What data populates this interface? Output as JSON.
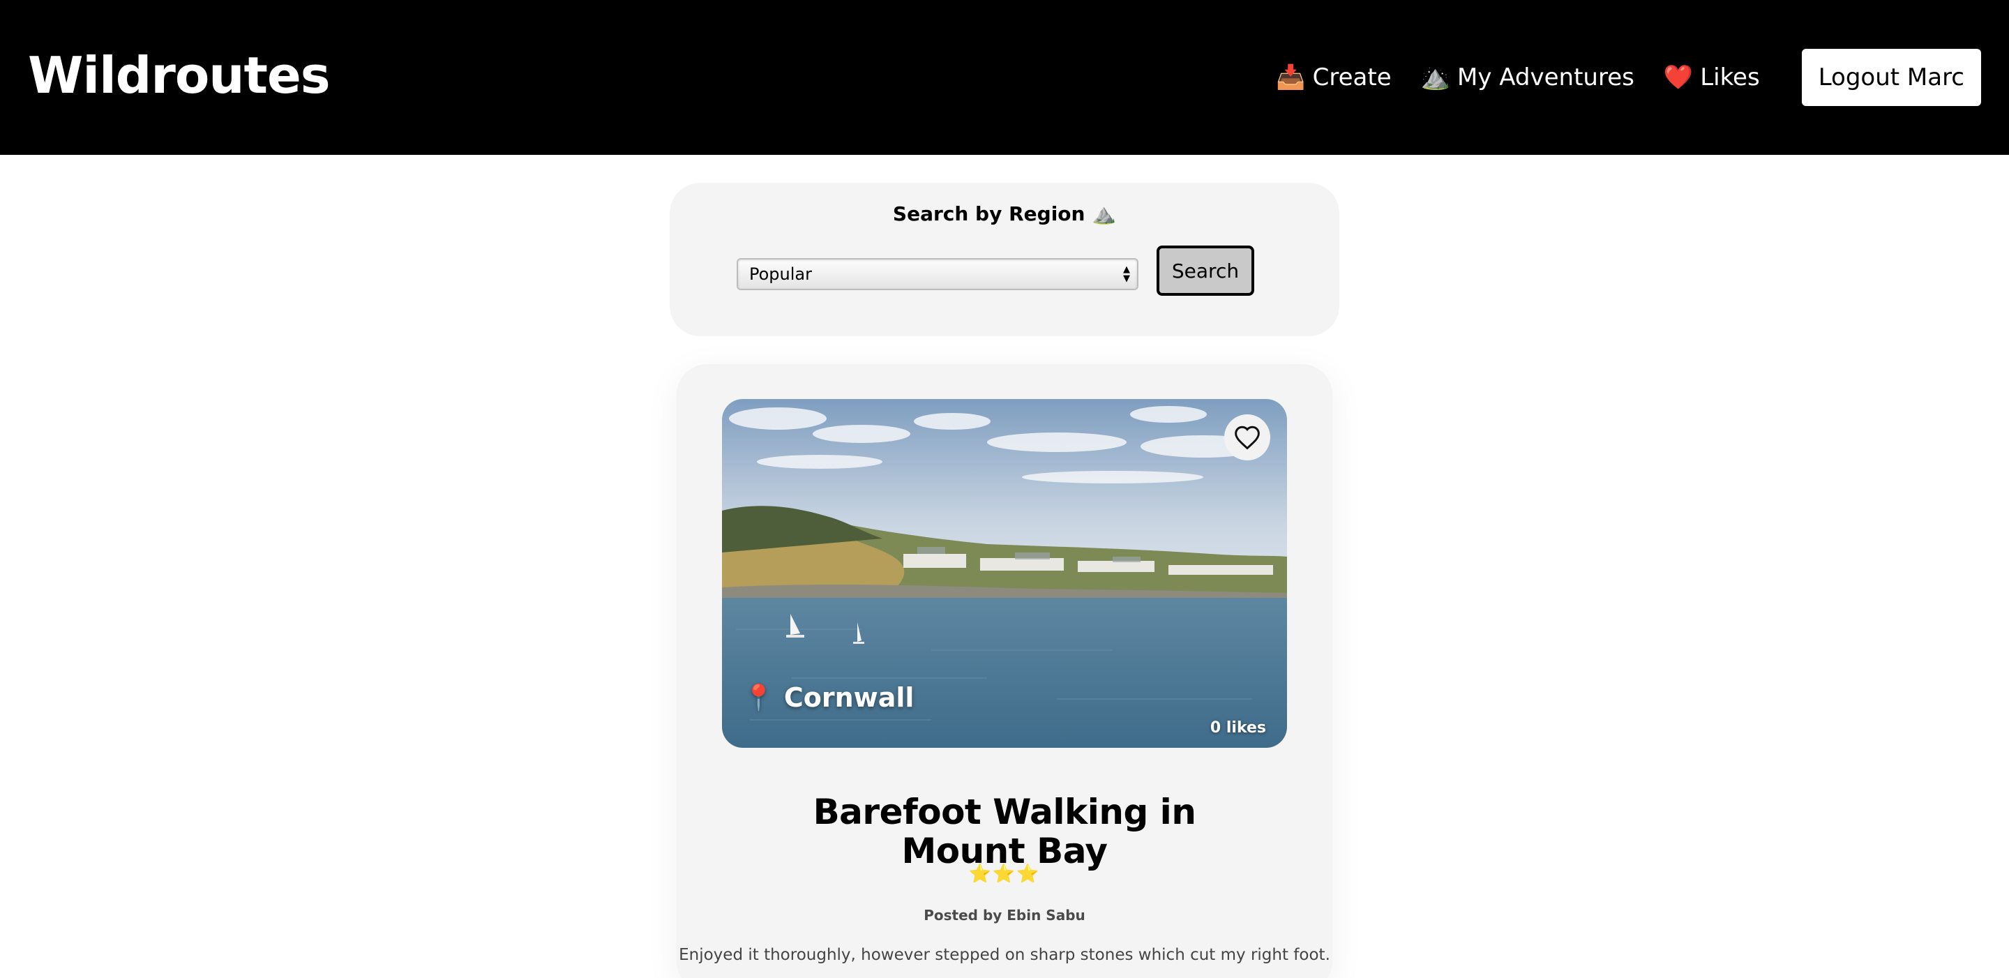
{
  "header": {
    "brand": "Wildroutes",
    "nav": [
      {
        "icon": "inbox-tray-icon",
        "emoji": "📥",
        "label": "Create"
      },
      {
        "icon": "mountain-icon",
        "emoji": "⛰️",
        "label": "My Adventures"
      },
      {
        "icon": "heart-icon",
        "emoji": "❤️",
        "label": "Likes"
      }
    ],
    "logout_label": "Logout Marc"
  },
  "search": {
    "title": "Search by Region ⛰️",
    "selected_region": "Popular",
    "button_label": "Search"
  },
  "card": {
    "region": "Cornwall",
    "region_icon": "map-pin-icon",
    "likes": "0 likes",
    "title": "Barefoot Walking in Mount Bay",
    "rating": "⭐⭐⭐",
    "rating_value": 3,
    "posted_by": "Posted by Ebin Sabu",
    "review": "Enjoyed it thoroughly, however stepped on sharp stones which cut my right foot.",
    "image_desc_icon": "coastal-bay-photo"
  },
  "colors": {
    "header_bg": "#000000",
    "panel_bg": "#f4f4f4",
    "star": "#f5c518"
  }
}
